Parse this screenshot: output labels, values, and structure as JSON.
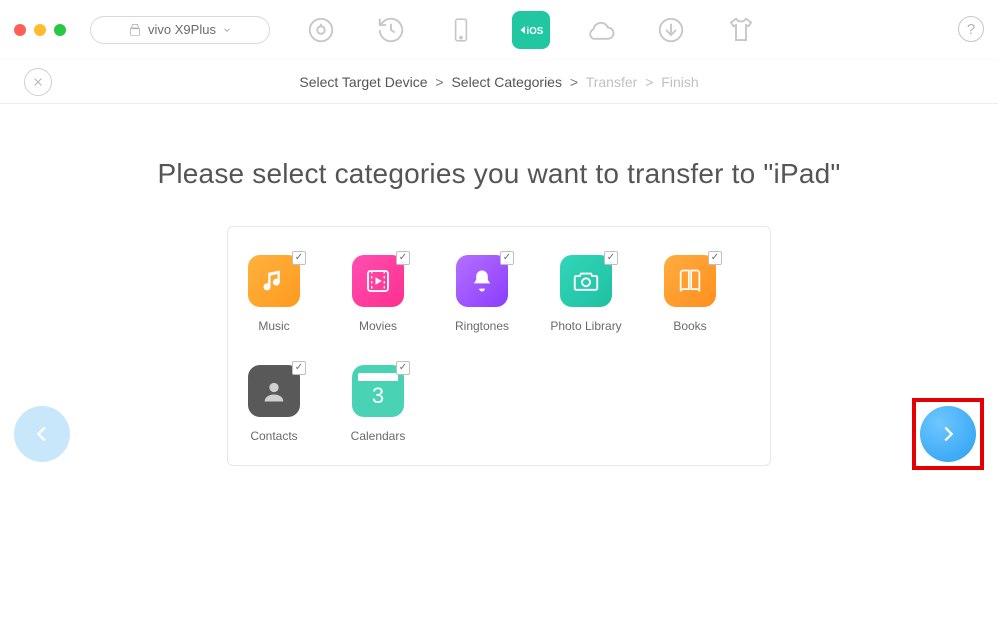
{
  "titlebar": {
    "device_name": "vivo X9Plus"
  },
  "toolbar_icons": {
    "music": "music-icon",
    "history": "history-icon",
    "phone": "phone-icon",
    "ios": "ios-icon",
    "cloud": "cloud-icon",
    "download": "download-icon",
    "tshirt": "tshirt-icon"
  },
  "help_label": "?",
  "breadcrumb": {
    "a": "Select Target Device",
    "b": "Select Categories",
    "c": "Transfer",
    "d": "Finish",
    "sep": ">"
  },
  "headline": "Please select categories you want to transfer to \"iPad\"",
  "categories": {
    "music": {
      "label": "Music",
      "checked": true
    },
    "movies": {
      "label": "Movies",
      "checked": true
    },
    "ringtones": {
      "label": "Ringtones",
      "checked": true
    },
    "photo": {
      "label": "Photo Library",
      "checked": true
    },
    "books": {
      "label": "Books",
      "checked": true
    },
    "contacts": {
      "label": "Contacts",
      "checked": true
    },
    "calendars": {
      "label": "Calendars",
      "checked": true
    }
  },
  "calendar_day": "3",
  "ios_badge": "iOS"
}
